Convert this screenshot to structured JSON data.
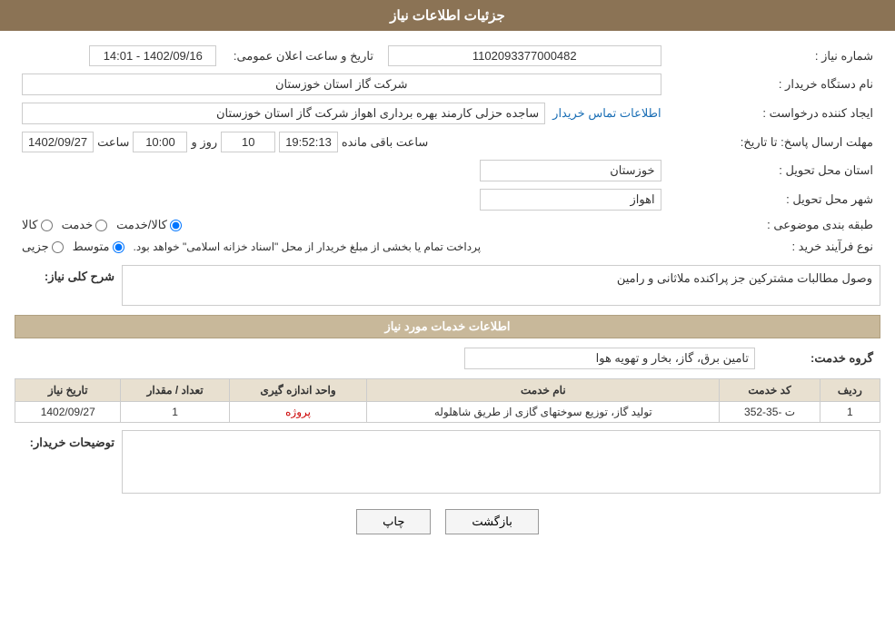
{
  "header": {
    "title": "جزئیات اطلاعات نیاز"
  },
  "fields": {
    "shomareNiaz_label": "شماره نیاز :",
    "shomareNiaz_value": "1102093377000482",
    "namDastgah_label": "نام دستگاه خریدار :",
    "namDastgah_value": "شرکت گاز استان خوزستان",
    "ijadKonande_label": "ایجاد کننده درخواست :",
    "ijadKonande_value": "ساجده حزلی کارمند بهره برداری اهواز شرکت گاز استان خوزستان",
    "ijadKonande_link": "اطلاعات تماس خریدار",
    "mohlat_label": "مهلت ارسال پاسخ: تا تاریخ:",
    "mohlat_date": "1402/09/27",
    "mohlat_saat": "10:00",
    "mohlat_saat_label": "ساعت",
    "mohlat_roz": "10",
    "mohlat_roz_label": "روز و",
    "mohlat_mande": "19:52:13",
    "mohlat_mande_label": "ساعت باقی مانده",
    "ostan_label": "استان محل تحویل :",
    "ostan_value": "خوزستان",
    "shahr_label": "شهر محل تحویل :",
    "shahr_value": "اهواز",
    "tabaghe_label": "طبقه بندی موضوعی :",
    "tabaghe_kala": "کالا",
    "tabaghe_khedmat": "خدمت",
    "tabaghe_kala_khedmat": "کالا/خدمت",
    "now_farayand_label": "نوع فرآیند خرید :",
    "now_jozei": "جزیی",
    "now_motevaset": "متوسط",
    "now_desc": "پرداخت تمام یا بخشی از مبلغ خریدار از محل \"اسناد خزانه اسلامی\" خواهد بود.",
    "tarikh_label": "تاریخ و ساعت اعلان عمومی:",
    "tarikh_value": "1402/09/16 - 14:01",
    "sharh_niaz_label": "شرح کلی نیاز:",
    "sharh_niaz_value": "وصول مطالبات مشترکین جز پراکنده ملاثانی و رامین",
    "khadamat_header": "اطلاعات خدمات مورد نیاز",
    "grooh_khedmat_label": "گروه خدمت:",
    "grooh_khedmat_value": "تامین برق، گاز، بخار و تهویه هوا",
    "table": {
      "cols": [
        "ردیف",
        "کد خدمت",
        "نام خدمت",
        "واحد اندازه گیری",
        "تعداد / مقدار",
        "تاریخ نیاز"
      ],
      "rows": [
        {
          "radif": "1",
          "kod": "ت -35-352",
          "nam": "تولید گاز، توزیع سوختهای گازی از طریق شاهلوله",
          "vahed": "پروژه",
          "tedad": "1",
          "tarikh": "1402/09/27"
        }
      ]
    },
    "tozihat_label": "توضیحات خریدار:",
    "tozihat_value": ""
  },
  "buttons": {
    "print": "چاپ",
    "back": "بازگشت"
  }
}
